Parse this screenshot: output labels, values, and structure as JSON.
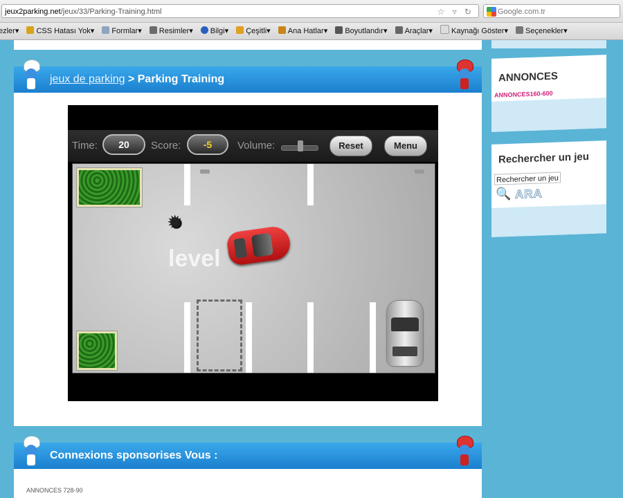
{
  "browser": {
    "url_host": "jeux2parking.net",
    "url_path": "/jeux/33/Parking-Training.html",
    "search_placeholder": "Google.com.tr",
    "toolbar_items": [
      "ezler",
      "CSS Hatası Yok",
      "Formlar",
      "Resimler",
      "Bilgi",
      "Çeşitli",
      "Ana Hatlar",
      "Boyutlandır",
      "Araçlar",
      "Kaynağı Göster",
      "Seçenekler"
    ]
  },
  "header": {
    "breadcrumb_link": "jeux de parking",
    "separator": " > ",
    "current": "Parking Training"
  },
  "game": {
    "time_label": "Time:",
    "time_value": "20",
    "score_label": "Score:",
    "score_value": "-5",
    "volume_label": "Volume:",
    "volume_level": 0.55,
    "reset_label": "Reset",
    "menu_label": "Menu",
    "level_text": "level"
  },
  "sidebar": {
    "ads_title": "ANNONCES",
    "ads_link": "ANNONCES160-600",
    "search_title": "Rechercher un jeu",
    "search_value": "Rechercher un jeu",
    "search_button": "ARA"
  },
  "sponsor": {
    "title": "Connexions sponsorises Vous :",
    "ad_text": "ANNONCES 728-90"
  },
  "colors": {
    "page_bg": "#5ab4d6",
    "header_blue": "#1b7fcf",
    "score_yellow": "#f2d233",
    "red_car": "#d62020"
  }
}
